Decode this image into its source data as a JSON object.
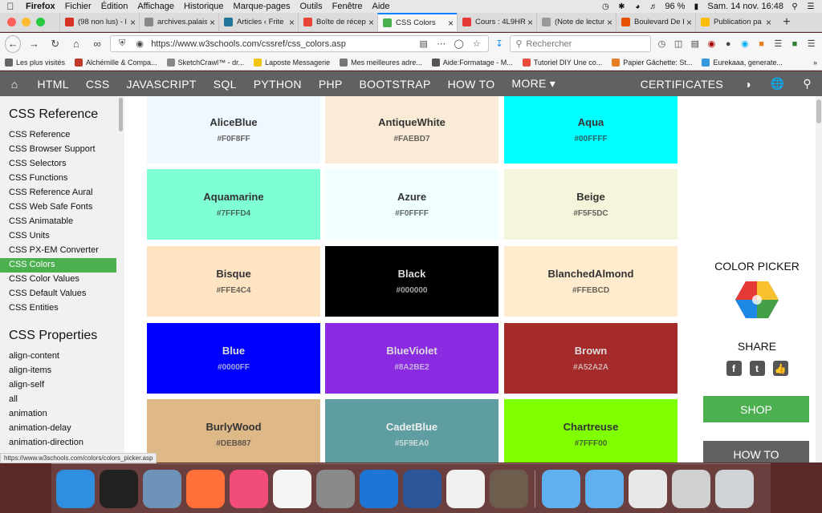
{
  "menubar": {
    "items": [
      "Firefox",
      "Fichier",
      "Édition",
      "Affichage",
      "Historique",
      "Marque-pages",
      "Outils",
      "Fenêtre",
      "Aide"
    ],
    "battery": "96 %",
    "clock": "Sam. 14 nov.  16:48"
  },
  "tabs": [
    {
      "label": "(98 non lus) - l",
      "color": "#d93025"
    },
    {
      "label": "archives.palais",
      "color": "#888888"
    },
    {
      "label": "Articles ‹ Frite",
      "color": "#21759b"
    },
    {
      "label": "Boîte de récept",
      "color": "#ea4335"
    },
    {
      "label": "CSS Colors",
      "color": "#4caf50",
      "active": true
    },
    {
      "label": "Cours : 4L9HR",
      "color": "#e53935"
    },
    {
      "label": "(Note de lecture), M",
      "color": "#999999"
    },
    {
      "label": "Boulevard De L",
      "color": "#e65100"
    },
    {
      "label": "Publication pa",
      "color": "#fbbc05"
    }
  ],
  "navbar": {
    "url": "https://www.w3schools.com/cssref/css_colors.asp",
    "search_placeholder": "Rechercher"
  },
  "bookmarks": [
    {
      "label": "Les plus visités",
      "color": "#666666"
    },
    {
      "label": "Alchémille & Compa...",
      "color": "#c0392b"
    },
    {
      "label": "SketchCrawl™ - dr...",
      "color": "#888888"
    },
    {
      "label": "Laposte Messagerie",
      "color": "#f1c40f"
    },
    {
      "label": "Mes meilleures adre...",
      "color": "#777777"
    },
    {
      "label": "Aide:Formatage - M...",
      "color": "#555555"
    },
    {
      "label": "Tutoriel DIY Une co...",
      "color": "#e74c3c"
    },
    {
      "label": "Papier Gâchette: St...",
      "color": "#e67e22"
    },
    {
      "label": "Eurekaaa, generate...",
      "color": "#3498db"
    }
  ],
  "w3nav": {
    "items": [
      "HTML",
      "CSS",
      "JAVASCRIPT",
      "SQL",
      "PYTHON",
      "PHP",
      "BOOTSTRAP",
      "HOW TO",
      "MORE ▾"
    ],
    "certificates": "CERTIFICATES"
  },
  "sidebar": {
    "heading1": "CSS Reference",
    "links": [
      "CSS Reference",
      "CSS Browser Support",
      "CSS Selectors",
      "CSS Functions",
      "CSS Reference Aural",
      "CSS Web Safe Fonts",
      "CSS Animatable",
      "CSS Units",
      "CSS PX-EM Converter",
      "CSS Colors",
      "CSS Color Values",
      "CSS Default Values",
      "CSS Entities"
    ],
    "active_link": "CSS Colors",
    "heading2": "CSS Properties",
    "properties": [
      "align-content",
      "align-items",
      "align-self",
      "all",
      "animation",
      "animation-delay",
      "animation-direction"
    ]
  },
  "colors": [
    {
      "name": "AliceBlue",
      "hex": "#F0F8FF",
      "bg": "#F0F8FF",
      "fg": "#333333"
    },
    {
      "name": "AntiqueWhite",
      "hex": "#FAEBD7",
      "bg": "#FAEBD7",
      "fg": "#333333"
    },
    {
      "name": "Aqua",
      "hex": "#00FFFF",
      "bg": "#00FFFF",
      "fg": "#333333"
    },
    {
      "name": "Aquamarine",
      "hex": "#7FFFD4",
      "bg": "#7FFFD4",
      "fg": "#333333"
    },
    {
      "name": "Azure",
      "hex": "#F0FFFF",
      "bg": "#F0FFFF",
      "fg": "#333333"
    },
    {
      "name": "Beige",
      "hex": "#F5F5DC",
      "bg": "#F5F5DC",
      "fg": "#333333"
    },
    {
      "name": "Bisque",
      "hex": "#FFE4C4",
      "bg": "#FFE4C4",
      "fg": "#333333"
    },
    {
      "name": "Black",
      "hex": "#000000",
      "bg": "#000000",
      "fg": "#dddddd"
    },
    {
      "name": "BlanchedAlmond",
      "hex": "#FFEBCD",
      "bg": "#FFEBCD",
      "fg": "#333333"
    },
    {
      "name": "Blue",
      "hex": "#0000FF",
      "bg": "#0000FF",
      "fg": "#dddddd"
    },
    {
      "name": "BlueViolet",
      "hex": "#8A2BE2",
      "bg": "#8A2BE2",
      "fg": "#dddddd"
    },
    {
      "name": "Brown",
      "hex": "#A52A2A",
      "bg": "#A52A2A",
      "fg": "#dddddd"
    },
    {
      "name": "BurlyWood",
      "hex": "#DEB887",
      "bg": "#DEB887",
      "fg": "#333333"
    },
    {
      "name": "CadetBlue",
      "hex": "#5F9EA0",
      "bg": "#5F9EA0",
      "fg": "#eeeeee"
    },
    {
      "name": "Chartreuse",
      "hex": "#7FFF00",
      "bg": "#7FFF00",
      "fg": "#333333"
    }
  ],
  "rightcol": {
    "color_picker": "COLOR PICKER",
    "share": "SHARE",
    "shop": "SHOP",
    "howto": "HOW TO"
  },
  "status_url": "https://www.w3schools.com/colors/colors_picker.asp",
  "dock": {
    "apps": [
      {
        "icon": "finder-icon",
        "color": "#2f8ee0"
      },
      {
        "icon": "dashboard-icon",
        "color": "#222222"
      },
      {
        "icon": "preview-icon",
        "color": "#6f93b8"
      },
      {
        "icon": "firefox-icon",
        "color": "#ff7139"
      },
      {
        "icon": "itunes-icon",
        "color": "#f24d7a"
      },
      {
        "icon": "photos-icon",
        "color": "#f5f5f5"
      },
      {
        "icon": "calculator-icon",
        "color": "#8a8a8a"
      },
      {
        "icon": "keynote-icon",
        "color": "#1d75d6"
      },
      {
        "icon": "word-icon",
        "color": "#2b579a"
      },
      {
        "icon": "textedit-icon",
        "color": "#f0f0f0"
      },
      {
        "icon": "gimp-icon",
        "color": "#6e5d4d"
      },
      {
        "icon": "documents-folder-icon",
        "color": "#5fb0ee"
      },
      {
        "icon": "applications-folder-icon",
        "color": "#5fb0ee"
      },
      {
        "icon": "document-stack-icon",
        "color": "#e8e8e8"
      },
      {
        "icon": "firefox-window-icon",
        "color": "#d0d0d0"
      },
      {
        "icon": "trash-icon",
        "color": "#cfd3d6"
      }
    ]
  }
}
